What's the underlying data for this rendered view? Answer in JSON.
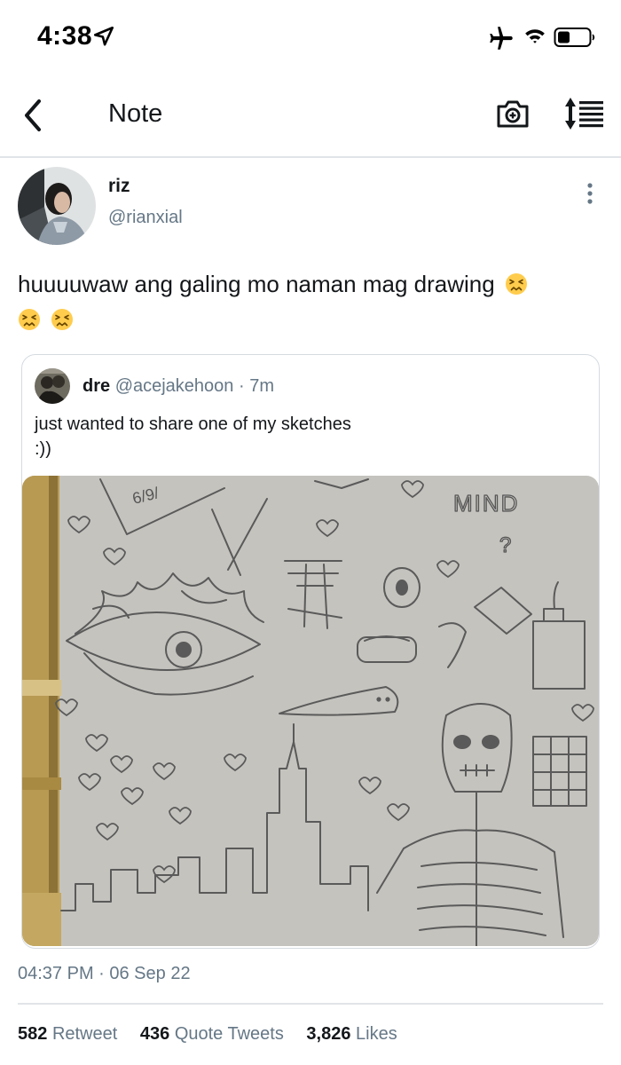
{
  "status_bar": {
    "time": "4:38",
    "icons": [
      "location-arrow-icon",
      "airplane-icon",
      "wifi-icon",
      "battery-icon"
    ]
  },
  "nav": {
    "title": "Note",
    "icons": [
      "back-chevron-icon",
      "camera-icon",
      "sort-icon"
    ]
  },
  "tweet": {
    "author_name": "riz",
    "author_handle": "@rianxial",
    "text": "huuuuwaw ang galing mo naman mag drawing",
    "emoji": [
      "confounded-face",
      "confounded-face",
      "confounded-face"
    ],
    "timestamp": "04:37 PM · 06 Sep 22"
  },
  "quote": {
    "author_name": "dre",
    "author_handle": "@acejakehoon",
    "separator": "·",
    "time": "7m",
    "text_line1": "just wanted to share one of my sketches",
    "text_line2": ":))",
    "image_text": {
      "mind": "MIND",
      "question": "?",
      "date": "6/9/"
    }
  },
  "stats": [
    {
      "count": "582",
      "label": "Retweet"
    },
    {
      "count": "436",
      "label": "Quote Tweets"
    },
    {
      "count": "3,826",
      "label": "Likes"
    }
  ],
  "colors": {
    "text_primary": "#14171a",
    "text_secondary": "#657786",
    "divider": "#e1e4e8",
    "paper": "#c9c7c2",
    "pen_gold": "#b89a52"
  }
}
